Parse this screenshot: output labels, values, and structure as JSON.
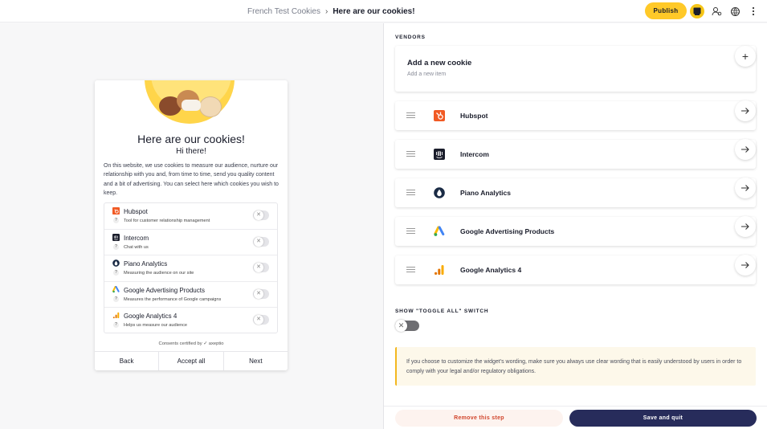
{
  "header": {
    "breadcrumb_parent": "French Test Cookies",
    "breadcrumb_separator": "›",
    "breadcrumb_current": "Here are our cookies!",
    "publish_label": "Publish",
    "icons": [
      "widget-preview-icon",
      "user-settings-icon",
      "language-globe-icon",
      "more-options-icon"
    ]
  },
  "widget": {
    "title": "Here are our cookies!",
    "subtitle": "Hi there!",
    "description": "On this website, we use cookies to measure our audience, nurture our relationship with you and, from time to time, send you quality content and a bit of advertising. You can select here which cookies you wish to keep.",
    "items": [
      {
        "name": "Hubspot",
        "description": "Tool for customer relationship management",
        "help": "?",
        "toggle": "✕"
      },
      {
        "name": "Intercom",
        "description": "Chat with us",
        "help": "?",
        "toggle": "✕"
      },
      {
        "name": "Piano Analytics",
        "description": "Measuring the audience on our site",
        "help": "?",
        "toggle": "✕"
      },
      {
        "name": "Google Advertising Products",
        "description": "Measures the performance of Google campaigns",
        "help": "?",
        "toggle": "✕"
      },
      {
        "name": "Google Analytics 4",
        "description": "Helps us measure our audience",
        "help": "?",
        "toggle": "✕"
      }
    ],
    "certified": "Consents certified by ✓ axeptio",
    "back_label": "Back",
    "accept_label": "Accept all",
    "next_label": "Next"
  },
  "panel": {
    "vendors_title": "VENDORS",
    "add_title": "Add a new cookie",
    "add_subtitle": "Add a new item",
    "add_icon": "+",
    "vendors": [
      {
        "name": "Hubspot",
        "icon": "hubspot-logo-icon"
      },
      {
        "name": "Intercom",
        "icon": "intercom-logo-icon"
      },
      {
        "name": "Piano Analytics",
        "icon": "piano-logo-icon"
      },
      {
        "name": "Google Advertising Products",
        "icon": "google-ads-logo-icon"
      },
      {
        "name": "Google Analytics 4",
        "icon": "google-analytics-logo-icon"
      }
    ],
    "toggle_all_title": "SHOW \"TOGGLE ALL\" SWITCH",
    "toggle_all_knob": "✕",
    "note": "If you choose to customize the widget's wording, make sure you always use clear wording that is easily understood by users in order to comply with your legal and/or regulatory obligations."
  },
  "footer": {
    "remove_label": "Remove this step",
    "save_label": "Save and quit"
  },
  "colors": {
    "accent_yellow": "#ffc928",
    "save_navy": "#272c5b",
    "remove_red": "#d1452c",
    "hubspot_orange": "#f15a24"
  }
}
